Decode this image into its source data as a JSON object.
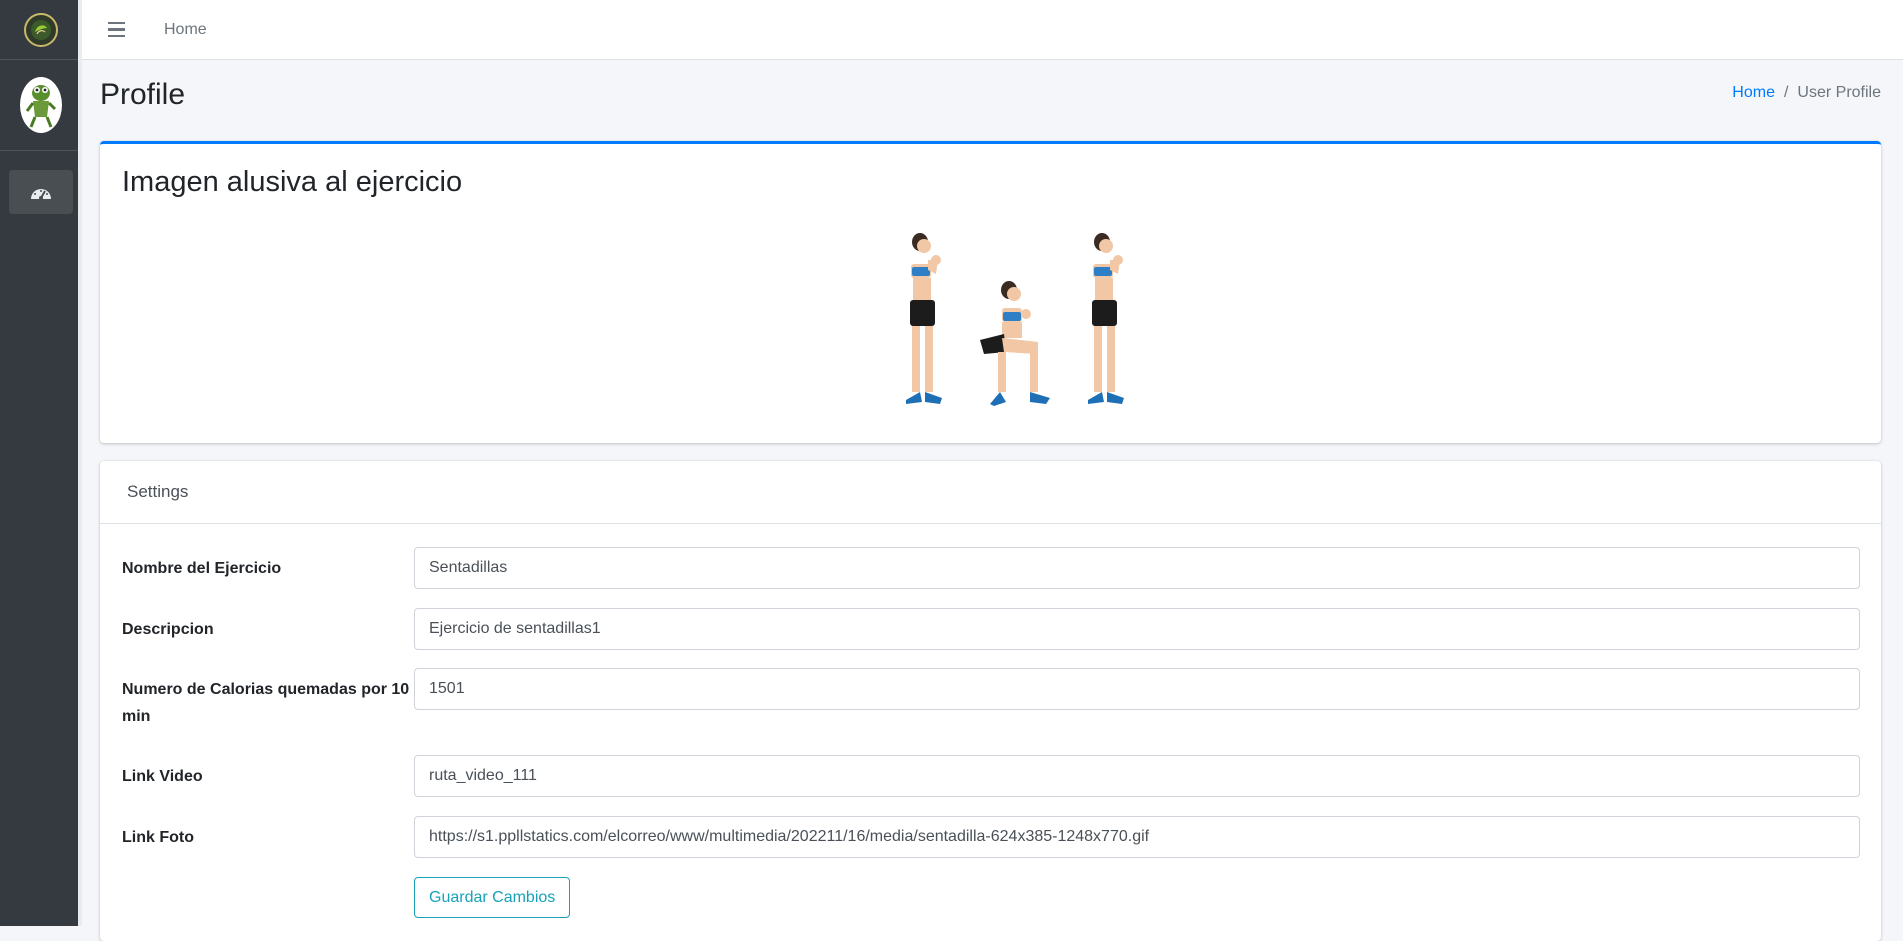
{
  "topbar": {
    "home_link": "Home"
  },
  "sidebar": {
    "dashboard_icon": "tachometer-icon"
  },
  "header": {
    "title": "Profile",
    "breadcrumb": {
      "home": "Home",
      "separator": "/",
      "current": "User Profile"
    }
  },
  "image_card": {
    "title": "Imagen alusiva al ejercicio"
  },
  "settings": {
    "header": "Settings",
    "fields": [
      {
        "label": "Nombre del Ejercicio",
        "value": "Sentadillas"
      },
      {
        "label": "Descripcion",
        "value": "Ejercicio de sentadillas1"
      },
      {
        "label": "Numero de Calorias quemadas por 10 min",
        "value": "1501"
      },
      {
        "label": "Link Video",
        "value": "ruta_video_111"
      },
      {
        "label": "Link Foto",
        "value": "https://s1.ppllstatics.com/elcorreo/www/multimedia/202211/16/media/sentadilla-624x385-1248x770.gif"
      }
    ],
    "save_label": "Guardar Cambios"
  },
  "colors": {
    "primary": "#007bff",
    "info": "#17a2b8",
    "sidebar": "#343a40"
  }
}
